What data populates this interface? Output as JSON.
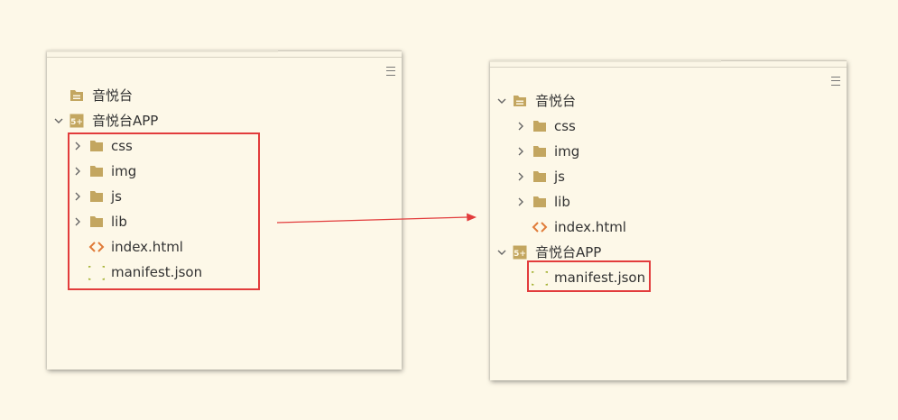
{
  "left_panel": {
    "items": {
      "root_folder": "音悦台",
      "app": "音悦台APP",
      "css": "css",
      "img": "img",
      "js": "js",
      "lib": "lib",
      "index": "index.html",
      "manifest": "manifest.json"
    }
  },
  "right_panel": {
    "items": {
      "root_folder": "音悦台",
      "css": "css",
      "img": "img",
      "js": "js",
      "lib": "lib",
      "index": "index.html",
      "app": "音悦台APP",
      "manifest": "manifest.json"
    }
  },
  "icon_names": [
    "folder-icon",
    "project-folder-icon",
    "app-project-icon",
    "html-file-icon",
    "json-file-icon",
    "chevron-right-icon",
    "chevron-down-icon",
    "menu-icon"
  ],
  "colors": {
    "background": "#fdf8e8",
    "folder": "#c3a660",
    "html_icon": "#e07b39",
    "json_icon": "#a8b43a",
    "highlight": "#e23c3c",
    "arrow": "#e23c3c"
  }
}
